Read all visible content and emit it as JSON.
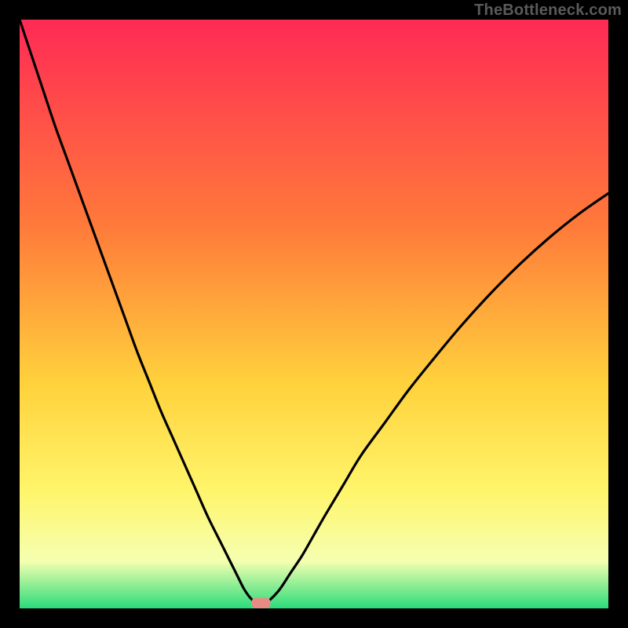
{
  "watermark": "TheBottleneck.com",
  "colors": {
    "frame": "#000000",
    "gradient_top": "#ff2a55",
    "gradient_mid1": "#ff7a3a",
    "gradient_mid2": "#ffd23c",
    "gradient_mid3": "#fff56b",
    "gradient_mid4": "#f5ffb0",
    "gradient_bottom": "#2bdc7b",
    "curve": "#000000",
    "marker_fill": "#e98b85",
    "marker_stroke": "#c46b66"
  },
  "chart_data": {
    "type": "line",
    "title": "",
    "xlabel": "",
    "ylabel": "",
    "xlim": [
      0,
      100
    ],
    "ylim": [
      0,
      100
    ],
    "x": [
      0,
      2,
      4,
      6,
      8,
      10,
      12,
      14,
      16,
      18,
      20,
      22,
      24,
      26,
      28,
      30,
      32,
      34,
      36,
      37,
      38,
      39,
      40,
      41,
      42,
      44,
      46,
      48,
      50,
      52,
      55,
      58,
      62,
      66,
      70,
      75,
      80,
      85,
      90,
      95,
      100
    ],
    "values": [
      100,
      94,
      88,
      82,
      76.5,
      71,
      65.5,
      60,
      54.5,
      49,
      43.5,
      38.5,
      33.5,
      29,
      24.5,
      20,
      15.5,
      11.5,
      7.5,
      5.5,
      3.5,
      2,
      1,
      0.5,
      1,
      3,
      6,
      9,
      12.5,
      16,
      21,
      26,
      31.5,
      37,
      42,
      48,
      53.5,
      58.5,
      63,
      67,
      70.5
    ],
    "marker": {
      "x": 41,
      "y": 0.5
    },
    "annotations": []
  }
}
